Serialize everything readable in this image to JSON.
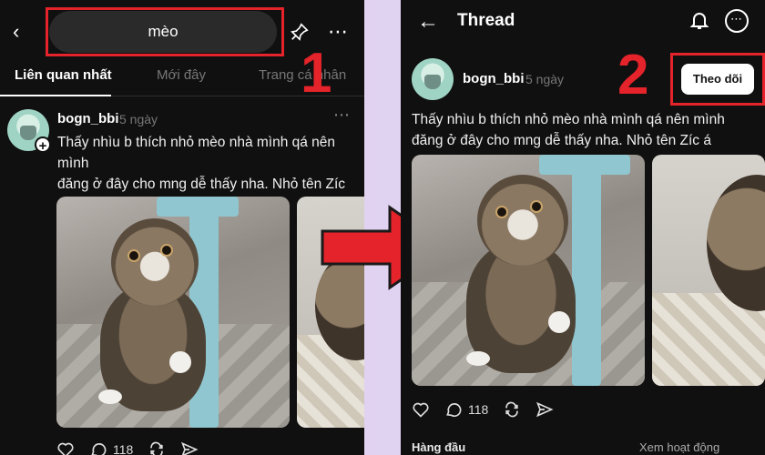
{
  "left": {
    "search_value": "mèo",
    "tabs": [
      "Liên quan nhất",
      "Mới đây",
      "Trang cá nhân"
    ],
    "step_label": "1",
    "post": {
      "username": "bogn_bbi",
      "time": "5 ngày",
      "text_line1": "Thấy nhìu b thích nhỏ mèo nhà mình qá nên mình",
      "text_line2": "đăng ở đây cho mng dễ thấy nha. Nhỏ tên Zíc á",
      "text_line3": ""
    },
    "replies_count": "118"
  },
  "right": {
    "title": "Thread",
    "step_label": "2",
    "follow_label": "Theo dõi",
    "post": {
      "username": "bogn_bbi",
      "time": "5 ngày",
      "text_line1": "Thấy nhìu b thích nhỏ mèo nhà mình qá nên mình",
      "text_line2": "đăng ở đây cho mng dễ thấy nha. Nhỏ tên Zíc á"
    },
    "replies_count": "118",
    "bottom_left": "Hàng đầu",
    "bottom_right": "Xem hoạt động"
  },
  "colors": {
    "highlight_red": "#e4232a",
    "background": "#101010"
  },
  "icons": [
    "back-icon",
    "pin-icon",
    "more-icon",
    "plus-icon",
    "heart-icon",
    "comment-icon",
    "repost-icon",
    "share-icon",
    "bell-icon",
    "back-arrow-icon",
    "arrow-icon"
  ]
}
